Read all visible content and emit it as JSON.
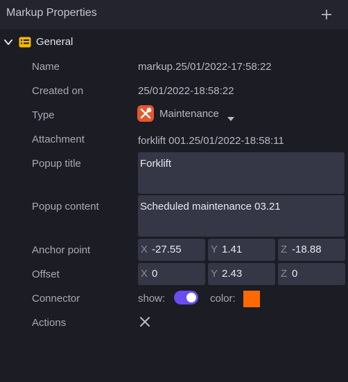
{
  "header": {
    "title": "Markup Properties",
    "add_icon": "plus-icon"
  },
  "section": {
    "label": "General",
    "expanded": true,
    "icon": "list-icon",
    "icon_color": "#f5b800"
  },
  "fields": {
    "name": {
      "label": "Name",
      "value": "markup.25/01/2022-17:58:22"
    },
    "created_on": {
      "label": "Created on",
      "value": "25/01/2022-18:58:22"
    },
    "type": {
      "label": "Type",
      "value": "Maintenance",
      "icon": "tools-icon",
      "icon_color": "#e4572e"
    },
    "attachment": {
      "label": "Attachment",
      "value": "forklift 001.25/01/2022-18:58:11"
    },
    "popup_title": {
      "label": "Popup title",
      "value": "Forklift"
    },
    "popup_content": {
      "label": "Popup content",
      "value": "Scheduled maintenance 03.21"
    },
    "anchor_point": {
      "label": "Anchor point",
      "x_label": "X",
      "x": "-27.55",
      "y_label": "Y",
      "y": "1.41",
      "z_label": "Z",
      "z": "-18.88"
    },
    "offset": {
      "label": "Offset",
      "x_label": "X",
      "x": "0",
      "y_label": "Y",
      "y": "2.43",
      "z_label": "Z",
      "z": "0"
    },
    "connector": {
      "label": "Connector",
      "show_label": "show:",
      "show": true,
      "color_label": "color:",
      "color": "#ff6a00"
    },
    "actions": {
      "label": "Actions",
      "icon": "close-icon"
    }
  }
}
